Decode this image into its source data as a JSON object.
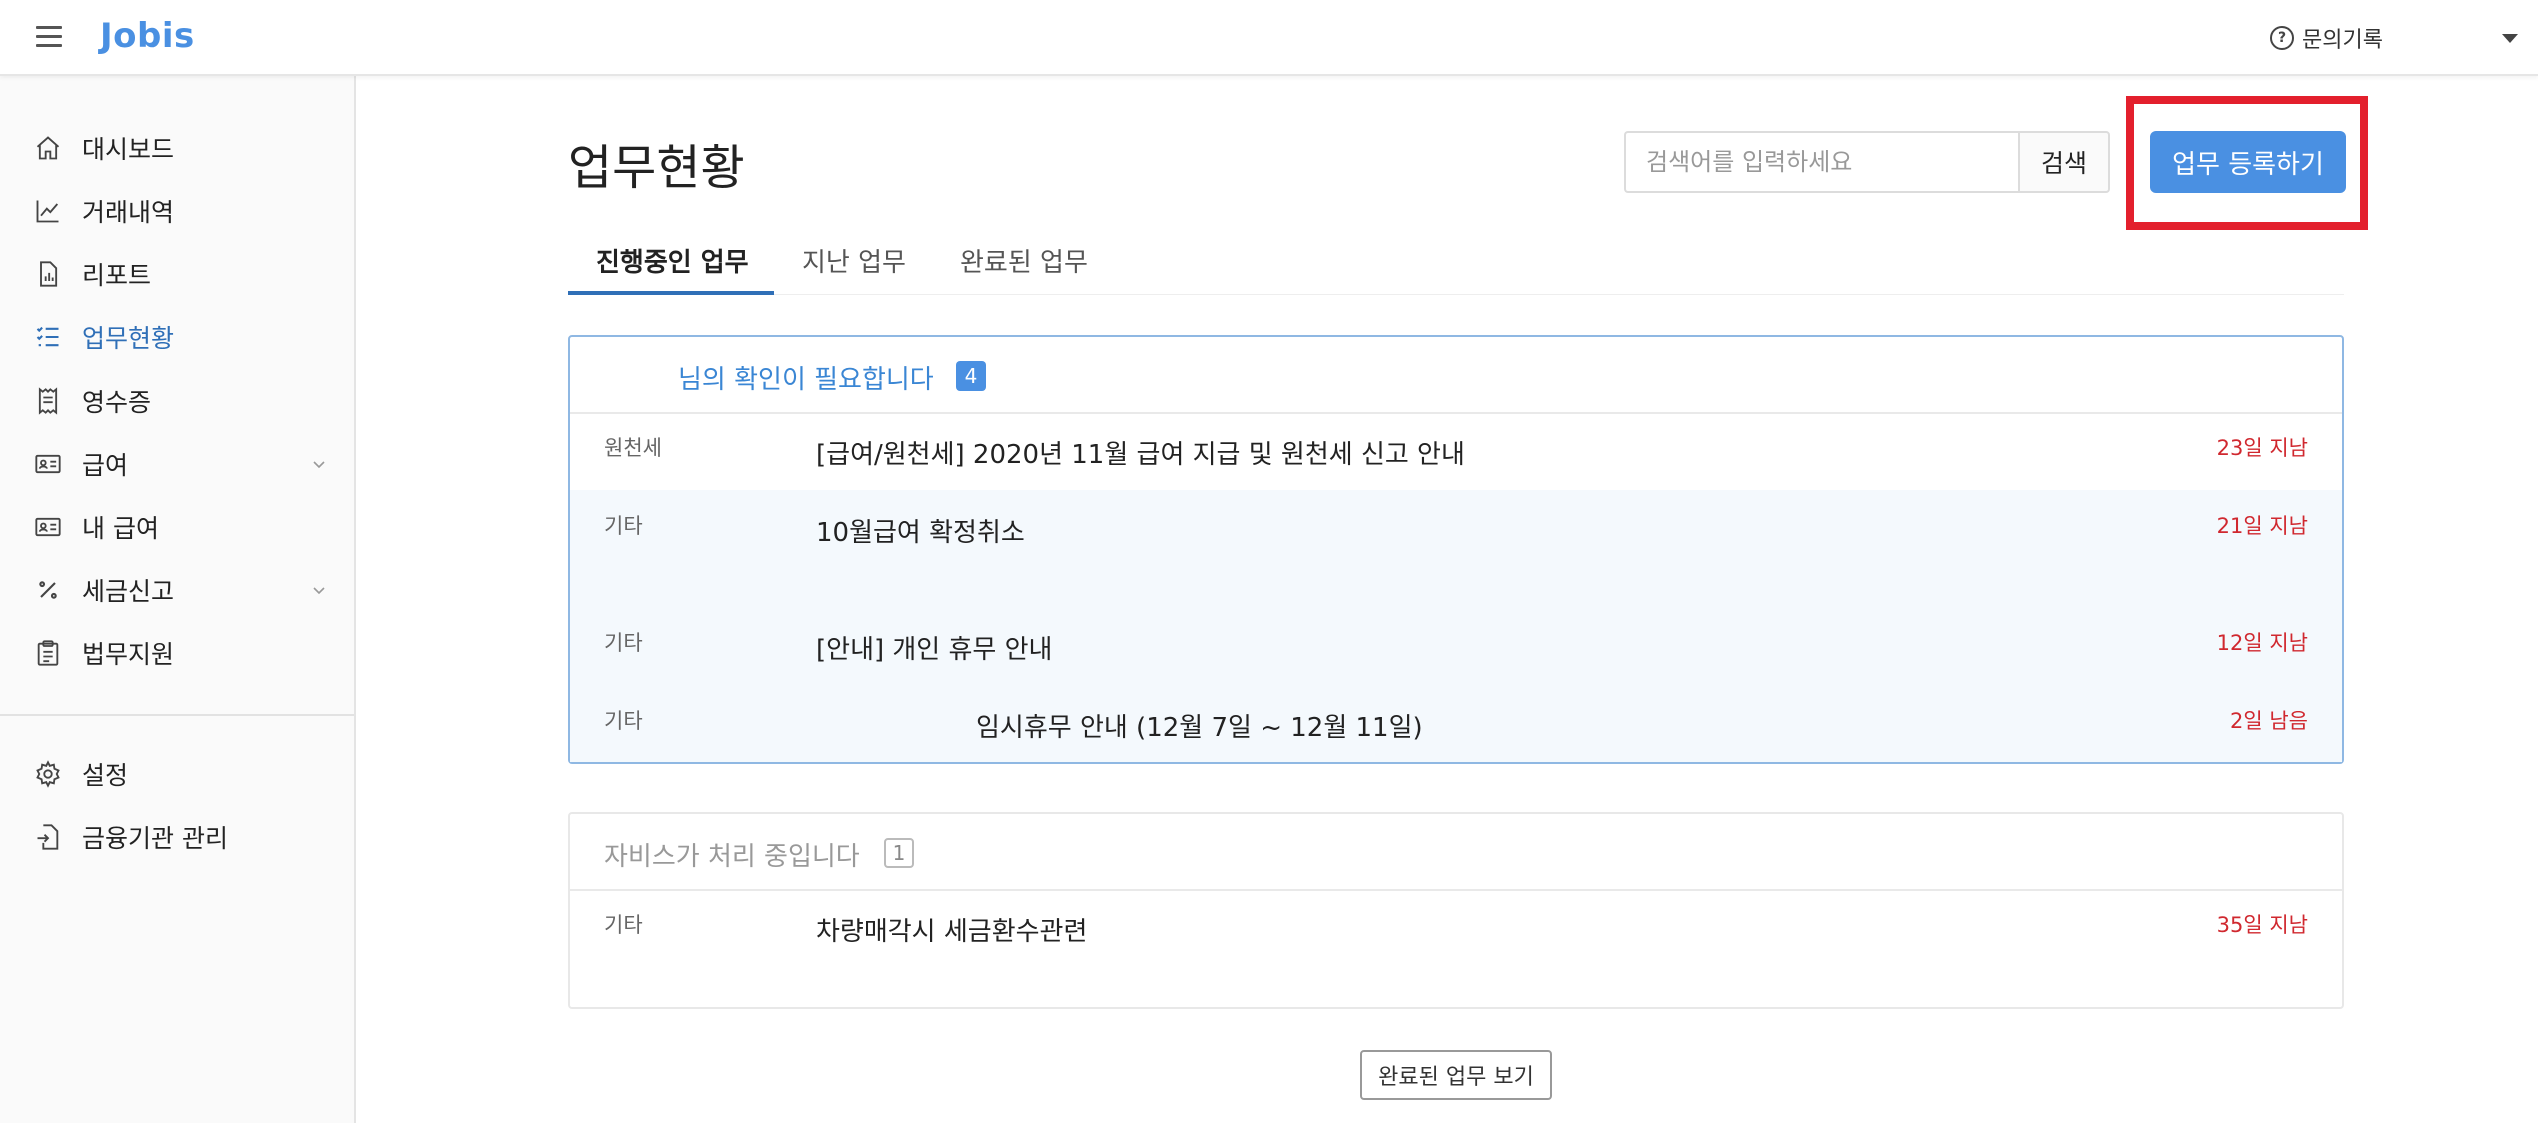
{
  "app": {
    "name": "Jobis"
  },
  "topbar": {
    "help_label": "문의기록"
  },
  "sidebar": {
    "items": [
      {
        "label": "대시보드",
        "icon": "home-icon",
        "active": false
      },
      {
        "label": "거래내역",
        "icon": "trend-chart-icon",
        "active": false
      },
      {
        "label": "리포트",
        "icon": "report-file-icon",
        "active": false
      },
      {
        "label": "업무현황",
        "icon": "task-list-icon",
        "active": true
      },
      {
        "label": "영수증",
        "icon": "receipt-icon",
        "active": false
      },
      {
        "label": "급여",
        "icon": "id-card-icon",
        "active": false,
        "expandable": true
      },
      {
        "label": "내 급여",
        "icon": "id-card-icon",
        "active": false
      },
      {
        "label": "세금신고",
        "icon": "percent-icon",
        "active": false,
        "expandable": true
      },
      {
        "label": "법무지원",
        "icon": "clipboard-icon",
        "active": false
      },
      {
        "label": "설정",
        "icon": "gear-icon",
        "active": false
      },
      {
        "label": "금융기관 관리",
        "icon": "import-file-icon",
        "active": false
      }
    ]
  },
  "main": {
    "title": "업무현황",
    "search": {
      "placeholder": "검색어를 입력하세요",
      "button_label": "검색"
    },
    "register_button_label": "업무 등록하기",
    "tabs": [
      {
        "label": "진행중인 업무",
        "active": true
      },
      {
        "label": "지난 업무",
        "active": false
      },
      {
        "label": "완료된 업무",
        "active": false
      }
    ],
    "needs_confirmation": {
      "title": "님의 확인이 필요합니다",
      "count": "4",
      "tasks": [
        {
          "category": "원천세",
          "title": "[급여/원천세] 2020년 11월 급여 지급 및 원천세 신고 안내",
          "due": "23일 지남"
        },
        {
          "category": "기타",
          "title": "10월급여 확정취소",
          "due": "21일 지남"
        },
        {
          "category": "기타",
          "title": "[안내] 개인 휴무 안내",
          "due": "12일 지남"
        },
        {
          "category": "기타",
          "title": "임시휴무 안내 (12월 7일 ~ 12월 11일)",
          "due": "2일 남음"
        }
      ]
    },
    "in_progress": {
      "title": "자비스가 처리 중입니다",
      "count": "1",
      "tasks": [
        {
          "category": "기타",
          "title": "차량매각시 세금환수관련",
          "due": "35일 지남"
        }
      ]
    },
    "completed_button_label": "완료된 업무 보기"
  },
  "colors": {
    "accent": "#4a90e2",
    "active_nav": "#2f6fb7",
    "overdue": "#d0282f",
    "highlight": "#e3202d"
  }
}
